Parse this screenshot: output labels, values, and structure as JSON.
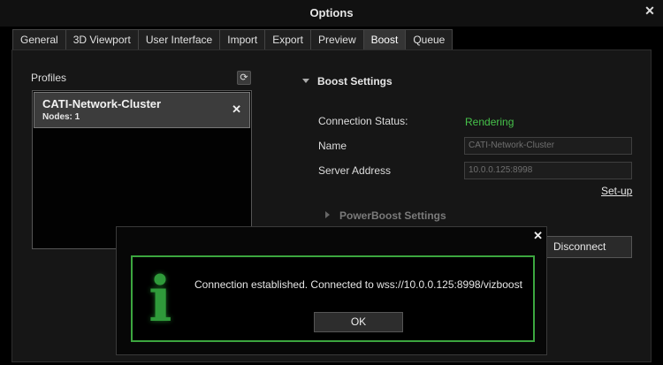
{
  "window": {
    "title": "Options",
    "close_glyph": "✕"
  },
  "tabs": [
    {
      "label": "General"
    },
    {
      "label": "3D Viewport"
    },
    {
      "label": "User Interface"
    },
    {
      "label": "Import"
    },
    {
      "label": "Export"
    },
    {
      "label": "Preview"
    },
    {
      "label": "Boost",
      "active": true
    },
    {
      "label": "Queue"
    }
  ],
  "profiles": {
    "label": "Profiles",
    "refresh_icon": "refresh-icon",
    "items": [
      {
        "name": "CATI-Network-Cluster",
        "nodes": "Nodes: 1",
        "remove_glyph": "✕"
      }
    ]
  },
  "boost_settings": {
    "header": "Boost Settings",
    "connection_status_label": "Connection Status:",
    "connection_status_value": "Rendering",
    "name_label": "Name",
    "name_value": "CATI-Network-Cluster",
    "server_address_label": "Server Address",
    "server_address_value": "10.0.0.125:8998",
    "setup_link": "Set-up",
    "status_color": "#46c24a"
  },
  "powerboost": {
    "header": "PowerBoost Settings"
  },
  "disconnect_label": "Disconnect",
  "dialog": {
    "close_glyph": "✕",
    "icon": "info-icon",
    "icon_glyph": "i",
    "message": "Connection established. Connected to wss://10.0.0.125:8998/vizboost",
    "ok_label": "OK",
    "accent_color": "#3ca63f"
  }
}
